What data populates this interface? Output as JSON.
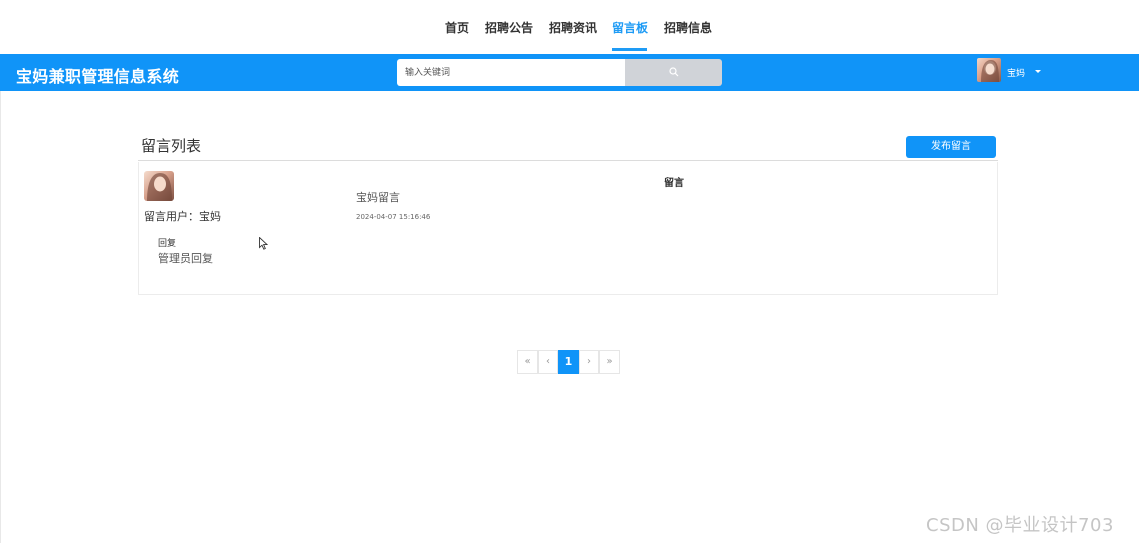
{
  "nav": {
    "items": [
      {
        "label": "首页"
      },
      {
        "label": "招聘公告"
      },
      {
        "label": "招聘资讯"
      },
      {
        "label": "留言板"
      },
      {
        "label": "招聘信息"
      }
    ],
    "active": "留言板",
    "accent": "#1e9bf5"
  },
  "header": {
    "site_title": "宝妈兼职管理信息系统",
    "bar_color": "#1094f8",
    "search": {
      "placeholder": "输入关键词",
      "value": ""
    },
    "user": {
      "name": "宝妈"
    }
  },
  "main": {
    "list_title": "留言列表",
    "post_button": "发布留言",
    "column_header": "留言",
    "messages": [
      {
        "user_label": "留言用户：宝妈",
        "content": "宝妈留言",
        "time": "2024-04-07 15:16:46",
        "reply_label": "回复",
        "reply_text": "管理员回复"
      }
    ]
  },
  "pagination": {
    "first": "«",
    "prev": "‹",
    "current": "1",
    "next": "›",
    "last": "»"
  },
  "watermark": "CSDN @毕业设计703"
}
